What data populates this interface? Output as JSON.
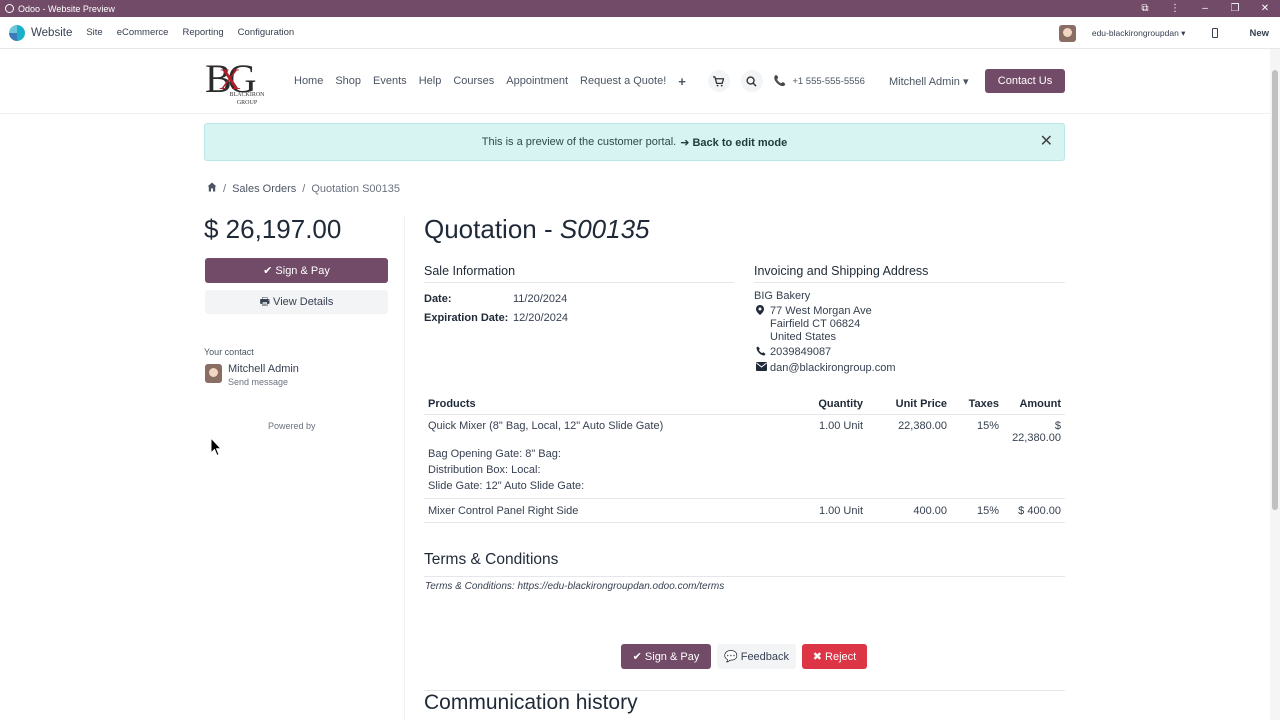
{
  "window": {
    "title": "Odoo - Website Preview",
    "controls": [
      "⧉",
      "⋮",
      "–",
      "❐",
      "✕"
    ]
  },
  "odoo_bar": {
    "app_name": "Website",
    "menus": [
      "Site",
      "eCommerce",
      "Reporting",
      "Configuration"
    ],
    "database": "edu-blackirongroupdan",
    "new_label": "New"
  },
  "site": {
    "brand": {
      "letters": "BG",
      "x": "X",
      "sub": "BLACKIRON GROUP"
    },
    "nav": [
      "Home",
      "Shop",
      "Events",
      "Help",
      "Courses",
      "Appointment",
      "Request a Quote!"
    ],
    "plus": "+",
    "cart_icon": "cart-icon",
    "search_icon": "search-icon",
    "phone": "+1 555-555-5556",
    "user": "Mitchell Admin",
    "contact_btn": "Contact Us"
  },
  "alert": {
    "text": "This is a preview of the customer portal.",
    "back": "➜ Back to edit mode",
    "close": "✕"
  },
  "breadcrumb": {
    "home_icon": "⌂",
    "sales_orders": "Sales Orders",
    "current": "Quotation S00135"
  },
  "sidebar": {
    "total": "$ 26,197.00",
    "sign_pay": "✔ Sign & Pay",
    "view_details": "🖶 View Details",
    "contact_label": "Your contact",
    "contact_name": "Mitchell Admin",
    "send_message": "Send message",
    "powered_by": "Powered by"
  },
  "quotation": {
    "title_prefix": "Quotation - ",
    "number": "S00135",
    "sale_info_heading": "Sale Information",
    "date_label": "Date:",
    "date_value": "11/20/2024",
    "expiration_label": "Expiration Date:",
    "expiration_value": "12/20/2024",
    "address_heading": "Invoicing and Shipping Address",
    "address": {
      "company": "BIG Bakery",
      "street": "77 West Morgan Ave",
      "city": "Fairfield CT 06824",
      "country": "United States",
      "phone": "2039849087",
      "email": "dan@blackirongroup.com"
    }
  },
  "products": {
    "headers": [
      "Products",
      "Quantity",
      "Unit Price",
      "Taxes",
      "Amount"
    ],
    "rows": [
      {
        "name": "Quick Mixer (8\" Bag, Local, 12\" Auto Slide Gate)",
        "quantity": "1.00 Unit",
        "unit_price": "22,380.00",
        "taxes": "15%",
        "amount": "$ 22,380.00",
        "details": [
          "Bag Opening Gate: 8\" Bag:",
          "Distribution Box: Local:",
          "Slide Gate: 12\" Auto Slide Gate:"
        ]
      },
      {
        "name": "Mixer Control Panel Right Side",
        "quantity": "1.00 Unit",
        "unit_price": "400.00",
        "taxes": "15%",
        "amount": "$ 400.00"
      }
    ]
  },
  "terms": {
    "heading": "Terms & Conditions",
    "label": "Terms & Conditions: ",
    "url": "https://edu-blackirongroupdan.odoo.com/terms"
  },
  "actions": {
    "sign_pay": "✔ Sign & Pay",
    "feedback": "💬 Feedback",
    "reject": "✖ Reject"
  },
  "communication": {
    "heading": "Communication history"
  },
  "colors": {
    "brand": "#714b67",
    "reject": "#dc3545",
    "alert_bg": "#d7f3f2"
  }
}
